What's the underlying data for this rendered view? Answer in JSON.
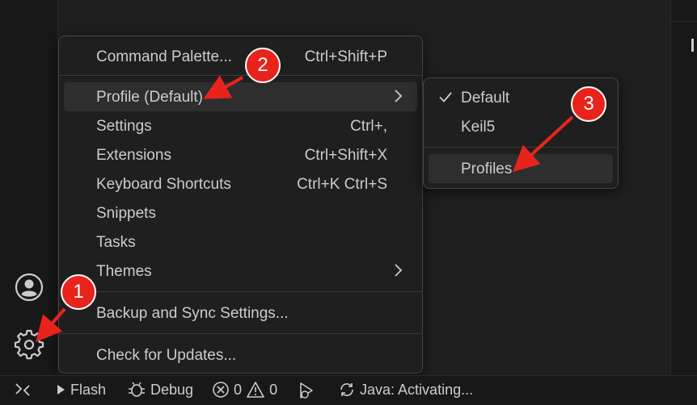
{
  "menu": {
    "items": [
      {
        "label": "Command Palette...",
        "shortcut": "Ctrl+Shift+P"
      },
      {
        "label": "Profile (Default)",
        "shortcut": ""
      },
      {
        "label": "Settings",
        "shortcut": "Ctrl+,"
      },
      {
        "label": "Extensions",
        "shortcut": "Ctrl+Shift+X"
      },
      {
        "label": "Keyboard Shortcuts",
        "shortcut": "Ctrl+K Ctrl+S"
      },
      {
        "label": "Snippets",
        "shortcut": ""
      },
      {
        "label": "Tasks",
        "shortcut": ""
      },
      {
        "label": "Themes",
        "shortcut": ""
      },
      {
        "label": "Backup and Sync Settings...",
        "shortcut": ""
      },
      {
        "label": "Check for Updates...",
        "shortcut": ""
      }
    ]
  },
  "submenu": {
    "items": [
      {
        "label": "Default",
        "checked": true
      },
      {
        "label": "Keil5",
        "checked": false
      },
      {
        "label": "Profiles",
        "checked": false
      }
    ]
  },
  "annotations": {
    "badge1": "1",
    "badge2": "2",
    "badge3": "3",
    "color": "#e8231c"
  },
  "statusbar": {
    "flash": "Flash",
    "debug": "Debug",
    "errors": "0",
    "warnings": "0",
    "java": "Java: Activating..."
  },
  "icons": {
    "account": "account-icon",
    "manage": "gear-icon",
    "remote": "remote-icon",
    "check": "check-icon",
    "chevron": "chevron-right-icon"
  },
  "colors": {
    "background": "#1f1f1f",
    "menu_border": "#454545",
    "highlight": "#2e2e2e",
    "text": "#cccccc"
  }
}
